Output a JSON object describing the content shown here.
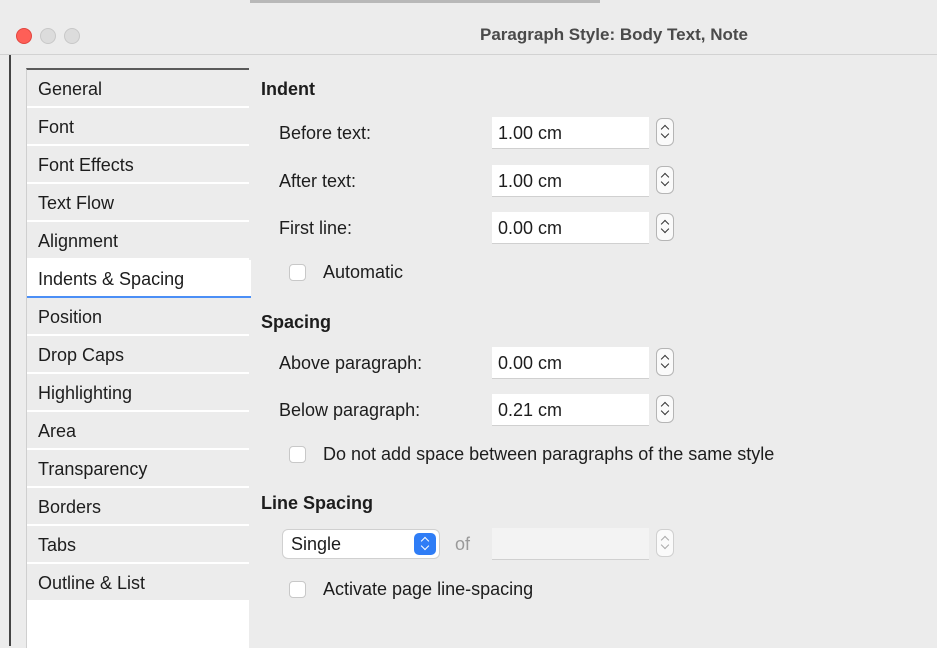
{
  "window": {
    "title": "Paragraph Style: Body Text, Note"
  },
  "sidebar": {
    "tabs": [
      {
        "label": "General"
      },
      {
        "label": "Font"
      },
      {
        "label": "Font Effects"
      },
      {
        "label": "Text Flow"
      },
      {
        "label": "Alignment"
      },
      {
        "label": "Indents & Spacing",
        "active": true
      },
      {
        "label": "Position"
      },
      {
        "label": "Drop Caps"
      },
      {
        "label": "Highlighting"
      },
      {
        "label": "Area"
      },
      {
        "label": "Transparency"
      },
      {
        "label": "Borders"
      },
      {
        "label": "Tabs"
      },
      {
        "label": "Outline & List"
      }
    ]
  },
  "indent": {
    "heading": "Indent",
    "before_label": "Before text:",
    "before_value": "1.00 cm",
    "after_label": "After text:",
    "after_value": "1.00 cm",
    "first_label": "First line:",
    "first_value": "0.00 cm",
    "automatic_label": "Automatic",
    "automatic_checked": false
  },
  "spacing": {
    "heading": "Spacing",
    "above_label": "Above paragraph:",
    "above_value": "0.00 cm",
    "below_label": "Below paragraph:",
    "below_value": "0.21 cm",
    "no_space_label": "Do not add space between paragraphs of the same style",
    "no_space_checked": false
  },
  "line_spacing": {
    "heading": "Line Spacing",
    "mode": "Single",
    "of_label": "of",
    "of_value": "",
    "activate_label": "Activate page line-spacing",
    "activate_checked": false
  },
  "colors": {
    "accent": "#2f7df6",
    "close_button": "#fe5f57",
    "active_tab_underline": "#4b8ff6"
  }
}
